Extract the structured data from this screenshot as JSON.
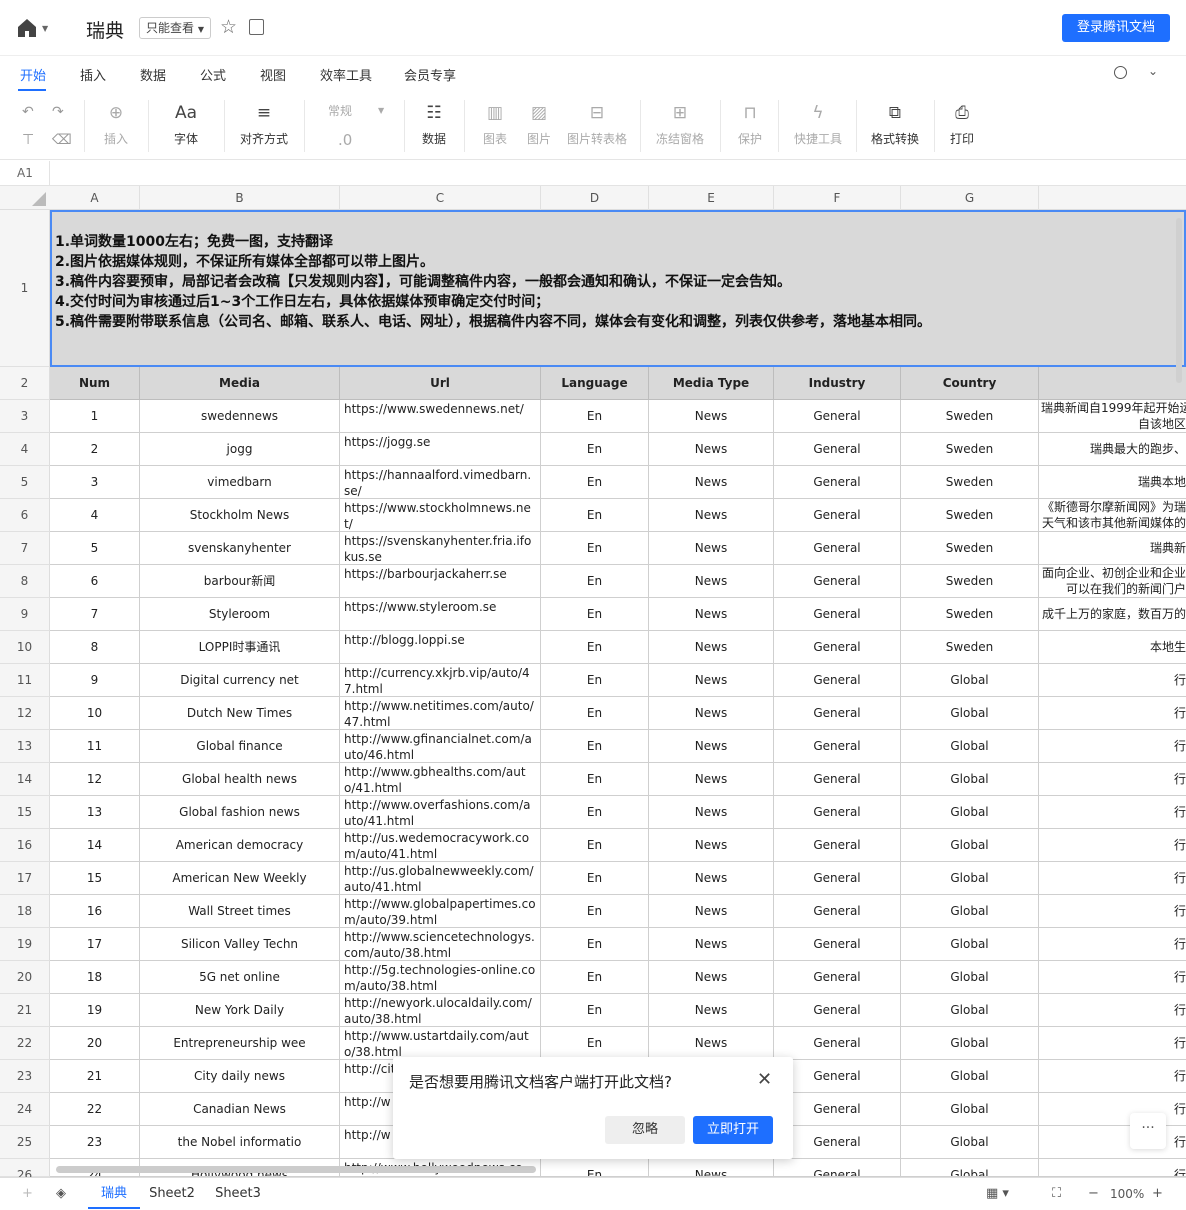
{
  "header": {
    "title": "瑞典",
    "view_mode": "只能查看",
    "login_label": "登录腾讯文档"
  },
  "menu": [
    "开始",
    "插入",
    "数据",
    "公式",
    "视图",
    "效率工具",
    "会员专享"
  ],
  "toolbar": {
    "insert": "插入",
    "font": "字体",
    "align": "对齐方式",
    "format": "常规",
    "decimal": ".0",
    "data": "数据",
    "chart": "图表",
    "image": "图片",
    "img2table": "图片转表格",
    "freeze": "冻结窗格",
    "protect": "保护",
    "quick": "快捷工具",
    "convert": "格式转换",
    "print": "打印"
  },
  "cell_ref": "A1",
  "columns": [
    "A",
    "B",
    "C",
    "D",
    "E",
    "F",
    "G"
  ],
  "notes": [
    "1.单词数量1000左右；免费一图，支持翻译",
    "2.图片依据媒体规则，不保证所有媒体全部都可以带上图片。",
    "3.稿件内容要预审，局部记者会改稿【只发规则内容】，可能调整稿件内容，一般都会通知和确认，不保证一定会告知。",
    "4.交付时间为审核通过后1~3个工作日左右，具体依据媒体预审确定交付时间；",
    "5.稿件需要附带联系信息（公司名、邮箱、联系人、电话、网址），根据稿件内容不同，媒体会有变化和调整，列表仅供参考，落地基本相同。"
  ],
  "table_headers": [
    "Num",
    "Media",
    "Url",
    "Language",
    "Media Type",
    "Industry",
    "Country"
  ],
  "rows": [
    {
      "num": "1",
      "media": "swedennews",
      "url": "https://www.swedennews.net/",
      "lang": "En",
      "type": "News",
      "ind": "General",
      "country": "Sweden",
      "desc": [
        "瑞典新闻自1999年起开始运",
        "自该地区"
      ]
    },
    {
      "num": "2",
      "media": "jogg",
      "url": "https://jogg.se",
      "lang": "En",
      "type": "News",
      "ind": "General",
      "country": "Sweden",
      "desc": [
        "瑞典最大的跑步、"
      ]
    },
    {
      "num": "3",
      "media": "vimedbarn",
      "url": "https://hannaalford.vimedbarn.se/",
      "lang": "En",
      "type": "News",
      "ind": "General",
      "country": "Sweden",
      "desc": [
        "瑞典本地"
      ]
    },
    {
      "num": "4",
      "media": "Stockholm News",
      "url": "https://www.stockholmnews.net/",
      "lang": "En",
      "type": "News",
      "ind": "General",
      "country": "Sweden",
      "desc": [
        "《斯德哥尔摩新闻网》为瑞",
        "天气和该市其他新闻媒体的"
      ]
    },
    {
      "num": "5",
      "media": "svenskanyhenter",
      "url": "https://svenskanyhenter.fria.ifokus.se",
      "lang": "En",
      "type": "News",
      "ind": "General",
      "country": "Sweden",
      "desc": [
        "瑞典新"
      ]
    },
    {
      "num": "6",
      "media": "barbour新闻",
      "url": "https://barbourjackaherr.se",
      "lang": "En",
      "type": "News",
      "ind": "General",
      "country": "Sweden",
      "desc": [
        "面向企业、初创企业和企业",
        "可以在我们的新闻门户"
      ]
    },
    {
      "num": "7",
      "media": "Styleroom",
      "url": "https://www.styleroom.se",
      "lang": "En",
      "type": "News",
      "ind": "General",
      "country": "Sweden",
      "desc": [
        "成千上万的家庭，数百万的"
      ]
    },
    {
      "num": "8",
      "media": "LOPPI时事通讯",
      "url": "http://blogg.loppi.se",
      "lang": "En",
      "type": "News",
      "ind": "General",
      "country": "Sweden",
      "desc": [
        "本地生"
      ]
    },
    {
      "num": "9",
      "media": "Digital currency net",
      "url": "http://currency.xkjrb.vip/auto/47.html",
      "lang": "En",
      "type": "News",
      "ind": "General",
      "country": "Global",
      "desc": [
        "行"
      ]
    },
    {
      "num": "10",
      "media": "Dutch New Times",
      "url": "http://www.netitimes.com/auto/47.html",
      "lang": "En",
      "type": "News",
      "ind": "General",
      "country": "Global",
      "desc": [
        "行"
      ]
    },
    {
      "num": "11",
      "media": "Global finance",
      "url": "http://www.gfinancialnet.com/auto/46.html",
      "lang": "En",
      "type": "News",
      "ind": "General",
      "country": "Global",
      "desc": [
        "行"
      ]
    },
    {
      "num": "12",
      "media": "Global health news",
      "url": "http://www.gbhealths.com/auto/41.html",
      "lang": "En",
      "type": "News",
      "ind": "General",
      "country": "Global",
      "desc": [
        "行"
      ]
    },
    {
      "num": "13",
      "media": "Global fashion news",
      "url": "http://www.overfashions.com/auto/41.html",
      "lang": "En",
      "type": "News",
      "ind": "General",
      "country": "Global",
      "desc": [
        "行"
      ]
    },
    {
      "num": "14",
      "media": "American democracy",
      "url": "http://us.wedemocracywork.com/auto/41.html",
      "lang": "En",
      "type": "News",
      "ind": "General",
      "country": "Global",
      "desc": [
        "行"
      ]
    },
    {
      "num": "15",
      "media": "American New Weekly",
      "url": "http://us.globalnewweekly.com/auto/41.html",
      "lang": "En",
      "type": "News",
      "ind": "General",
      "country": "Global",
      "desc": [
        "行"
      ]
    },
    {
      "num": "16",
      "media": "Wall Street times",
      "url": "http://www.globalpapertimes.com/auto/39.html",
      "lang": "En",
      "type": "News",
      "ind": "General",
      "country": "Global",
      "desc": [
        "行"
      ]
    },
    {
      "num": "17",
      "media": "Silicon Valley Techn",
      "url": "http://www.sciencetechnologys.com/auto/38.html",
      "lang": "En",
      "type": "News",
      "ind": "General",
      "country": "Global",
      "desc": [
        "行"
      ]
    },
    {
      "num": "18",
      "media": "5G net online",
      "url": "http://5g.technologies-online.com/auto/38.html",
      "lang": "En",
      "type": "News",
      "ind": "General",
      "country": "Global",
      "desc": [
        "行"
      ]
    },
    {
      "num": "19",
      "media": "New York Daily",
      "url": "http://newyork.ulocaldaily.com/auto/38.html",
      "lang": "En",
      "type": "News",
      "ind": "General",
      "country": "Global",
      "desc": [
        "行"
      ]
    },
    {
      "num": "20",
      "media": "Entrepreneurship wee",
      "url": "http://www.ustartdaily.com/auto/38.html",
      "lang": "En",
      "type": "News",
      "ind": "General",
      "country": "Global",
      "desc": [
        "行"
      ]
    },
    {
      "num": "21",
      "media": "City daily news",
      "url": "http://cit 8.html",
      "lang": "",
      "type": "",
      "ind": "General",
      "country": "Global",
      "desc": [
        "行"
      ]
    },
    {
      "num": "22",
      "media": "Canadian News",
      "url": "http://w /39.html",
      "lang": "",
      "type": "",
      "ind": "General",
      "country": "Global",
      "desc": [
        "行"
      ]
    },
    {
      "num": "23",
      "media": "the Nobel informatio",
      "url": "http://w m/auto/3",
      "lang": "",
      "type": "",
      "ind": "General",
      "country": "Global",
      "desc": [
        "行"
      ]
    },
    {
      "num": "24",
      "media": "Hollywood news",
      "url": "http://www.hollywoodnews.com/",
      "lang": "En",
      "type": "News",
      "ind": "General",
      "country": "Global",
      "desc": [
        "行"
      ]
    }
  ],
  "dialog": {
    "text": "是否想要用腾讯文档客户端打开此文档?",
    "ignore": "忽略",
    "open": "立即打开"
  },
  "sheets": [
    "瑞典",
    "Sheet2",
    "Sheet3"
  ],
  "zoom": "100%"
}
